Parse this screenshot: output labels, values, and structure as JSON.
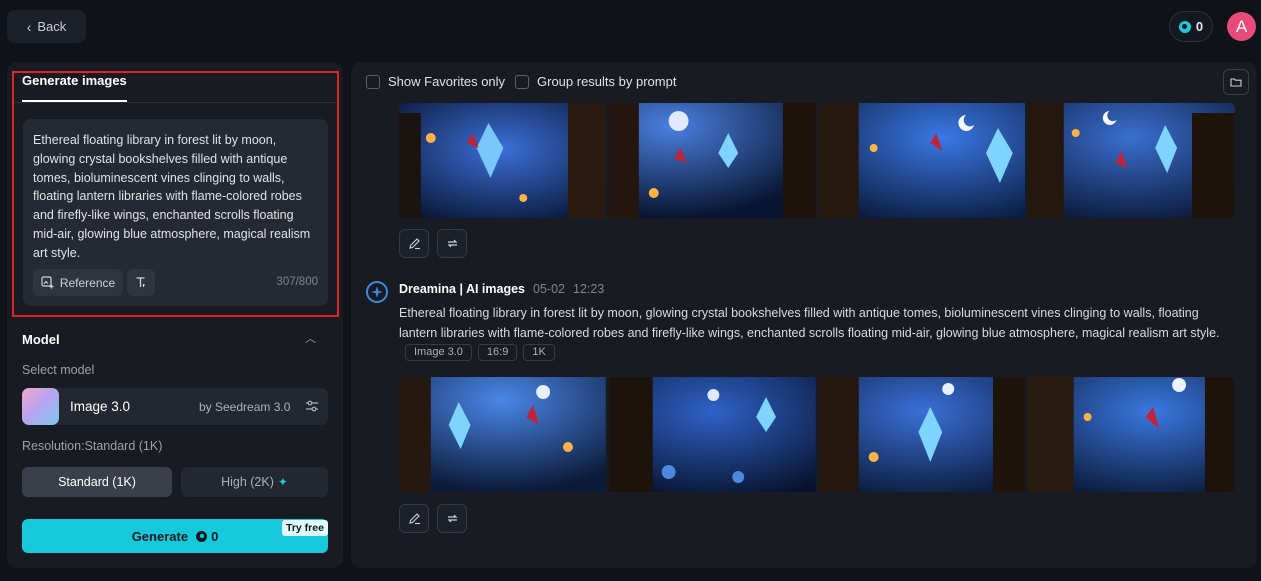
{
  "topbar": {
    "back_label": "Back",
    "credits": "0",
    "avatar_letter": "A"
  },
  "left": {
    "tab_label": "Generate images",
    "prompt": "Ethereal floating library in forest lit by moon, glowing crystal bookshelves filled with antique tomes, bioluminescent vines clinging to walls, floating lantern libraries with flame-colored robes and firefly-like wings, enchanted scrolls floating mid-air, glowing blue atmosphere, magical realism art style.",
    "reference_label": "Reference",
    "char_count": "307/800",
    "model_title": "Model",
    "select_model_label": "Select model",
    "model_name": "Image 3.0",
    "model_by": "by Seedream 3.0",
    "resolution_label": "Resolution:Standard (1K)",
    "res_standard": "Standard (1K)",
    "res_high": "High (2K)",
    "generate_label": "Generate",
    "generate_cost": "0",
    "try_free": "Try free"
  },
  "right": {
    "show_favorites_label": "Show Favorites only",
    "group_results_label": "Group results by prompt",
    "generation": {
      "author": "Dreamina | AI images",
      "date": "05-02",
      "time": "12:23",
      "prompt": "Ethereal floating library in forest lit by moon, glowing crystal bookshelves filled with antique tomes, bioluminescent vines clinging to walls, floating lantern libraries with flame-colored robes and firefly-like wings, enchanted scrolls floating mid-air, glowing blue atmosphere, magical realism art style.",
      "tags": [
        "Image 3.0",
        "16:9",
        "1K"
      ]
    }
  },
  "colors": {
    "accent": "#17c9dc",
    "highlight": "#e02424",
    "avatar": "#e84a7a"
  }
}
